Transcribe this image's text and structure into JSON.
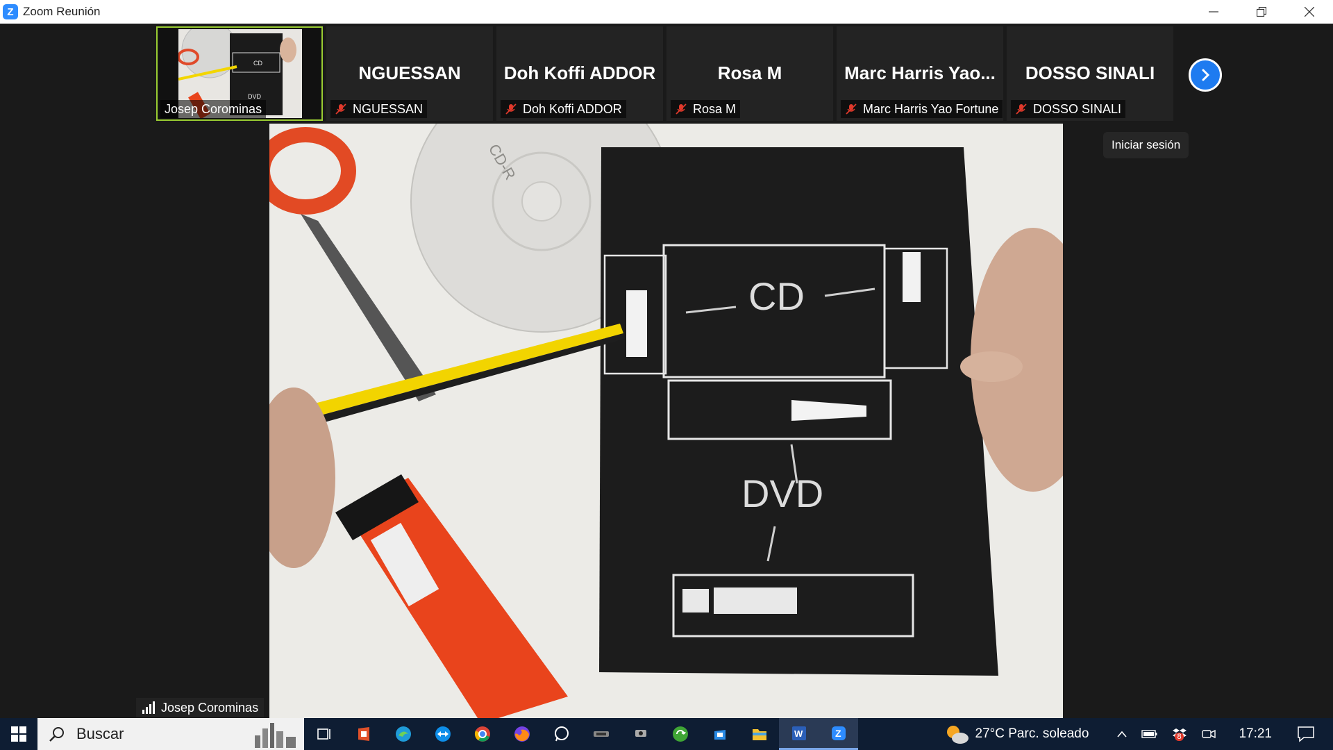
{
  "window": {
    "title": "Zoom Reunión",
    "app_icon_letter": "Z"
  },
  "participants": [
    {
      "name": "NGUESSAN",
      "label": "NGUESSAN",
      "muted": true
    },
    {
      "name": "Doh Koffi ADDOR",
      "label": "Doh Koffi ADDOR",
      "muted": true
    },
    {
      "name": "Rosa M",
      "label": "Rosa M",
      "muted": true
    },
    {
      "name": "Marc Harris Yao...",
      "label": "Marc Harris Yao Fortune",
      "muted": true
    },
    {
      "name": "DOSSO SINALI",
      "label": "DOSSO SINALI",
      "muted": true
    }
  ],
  "active_participant": {
    "label": "Josep Corominas"
  },
  "thumb_texts": {
    "cd": "CD",
    "dvd": "DVD"
  },
  "video": {
    "speaker_label": "Josep Corominas",
    "cd_label": "CD",
    "dvd_label": "DVD",
    "disc_label": "CD-R"
  },
  "signin_tooltip": "Iniciar sesión",
  "taskbar": {
    "search_placeholder": "Buscar",
    "weather": "27°C  Parc. soleado",
    "time": "17:21",
    "notification_badge": "8"
  },
  "colors": {
    "zoom_blue": "#2d8cff",
    "active_border": "#9acd32",
    "taskbar": "#0e1d33",
    "muted_red": "#e0392b"
  }
}
